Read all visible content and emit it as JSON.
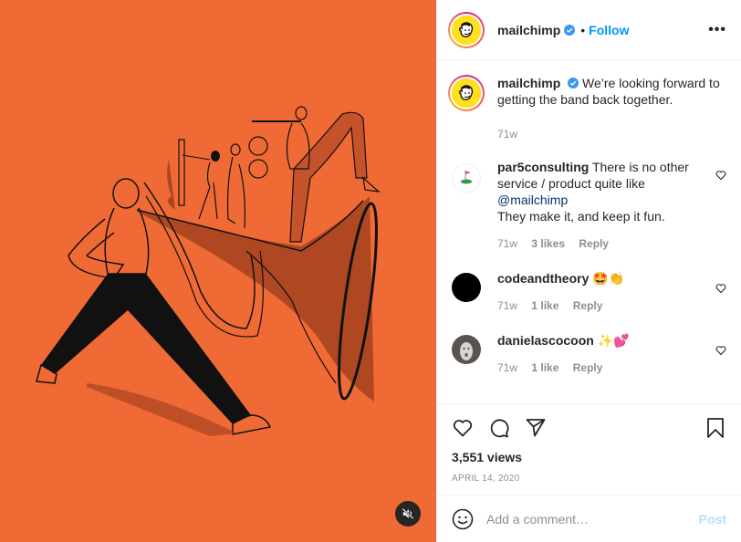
{
  "post": {
    "author": "mailchimp",
    "follow_label": "Follow",
    "separator": "•",
    "more_label": "•••",
    "media": {
      "background_color": "#f06a35",
      "description": "Illustration of a striding figure blowing a long horn while a small band plays on top of it",
      "mute_icon": "speaker-muted-icon"
    },
    "caption": {
      "username": "mailchimp",
      "text": "We’re looking forward to getting the band back together.",
      "time": "71w"
    },
    "comments": [
      {
        "username": "par5consulting",
        "text_before": "There is no other service / product quite like",
        "mention": "@mailchimp",
        "text_after": "They make it, and keep it fun.",
        "time": "71w",
        "likes": "3 likes",
        "reply": "Reply"
      },
      {
        "username": "codeandtheory",
        "text": "🤩👏",
        "time": "71w",
        "likes": "1 like",
        "reply": "Reply"
      },
      {
        "username": "danielascocoon",
        "text": "✨💕",
        "time": "71w",
        "likes": "1 like",
        "reply": "Reply"
      }
    ],
    "views": "3,551 views",
    "date": "APRIL 14, 2020",
    "add_comment_placeholder": "Add a comment…",
    "post_label": "Post",
    "colors": {
      "accent": "#0095f6",
      "post_disabled": "#b2dffc",
      "muted_text": "#8e8e8e",
      "mention": "#00376b"
    }
  }
}
